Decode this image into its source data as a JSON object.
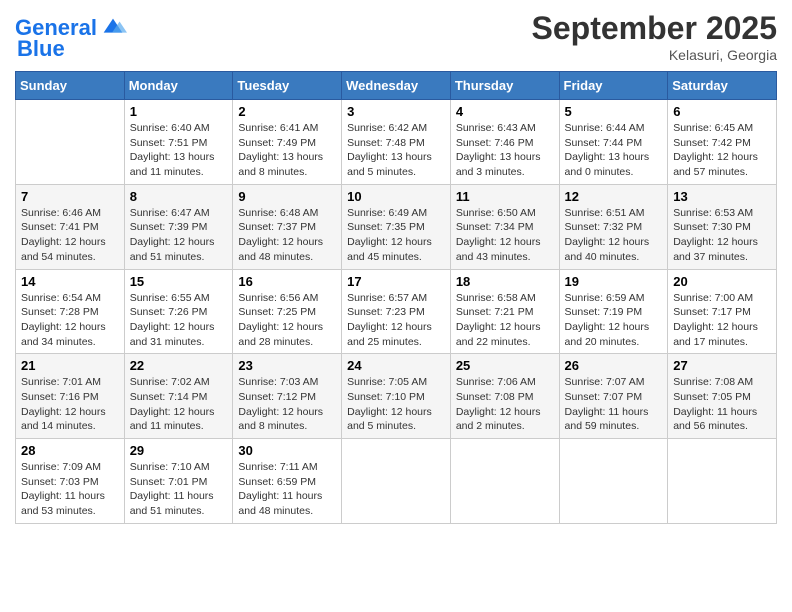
{
  "header": {
    "logo_line1": "General",
    "logo_line2": "Blue",
    "month": "September 2025",
    "location": "Kelasuri, Georgia"
  },
  "days_of_week": [
    "Sunday",
    "Monday",
    "Tuesday",
    "Wednesday",
    "Thursday",
    "Friday",
    "Saturday"
  ],
  "weeks": [
    [
      {
        "day": "",
        "info": ""
      },
      {
        "day": "1",
        "info": "Sunrise: 6:40 AM\nSunset: 7:51 PM\nDaylight: 13 hours\nand 11 minutes."
      },
      {
        "day": "2",
        "info": "Sunrise: 6:41 AM\nSunset: 7:49 PM\nDaylight: 13 hours\nand 8 minutes."
      },
      {
        "day": "3",
        "info": "Sunrise: 6:42 AM\nSunset: 7:48 PM\nDaylight: 13 hours\nand 5 minutes."
      },
      {
        "day": "4",
        "info": "Sunrise: 6:43 AM\nSunset: 7:46 PM\nDaylight: 13 hours\nand 3 minutes."
      },
      {
        "day": "5",
        "info": "Sunrise: 6:44 AM\nSunset: 7:44 PM\nDaylight: 13 hours\nand 0 minutes."
      },
      {
        "day": "6",
        "info": "Sunrise: 6:45 AM\nSunset: 7:42 PM\nDaylight: 12 hours\nand 57 minutes."
      }
    ],
    [
      {
        "day": "7",
        "info": "Sunrise: 6:46 AM\nSunset: 7:41 PM\nDaylight: 12 hours\nand 54 minutes."
      },
      {
        "day": "8",
        "info": "Sunrise: 6:47 AM\nSunset: 7:39 PM\nDaylight: 12 hours\nand 51 minutes."
      },
      {
        "day": "9",
        "info": "Sunrise: 6:48 AM\nSunset: 7:37 PM\nDaylight: 12 hours\nand 48 minutes."
      },
      {
        "day": "10",
        "info": "Sunrise: 6:49 AM\nSunset: 7:35 PM\nDaylight: 12 hours\nand 45 minutes."
      },
      {
        "day": "11",
        "info": "Sunrise: 6:50 AM\nSunset: 7:34 PM\nDaylight: 12 hours\nand 43 minutes."
      },
      {
        "day": "12",
        "info": "Sunrise: 6:51 AM\nSunset: 7:32 PM\nDaylight: 12 hours\nand 40 minutes."
      },
      {
        "day": "13",
        "info": "Sunrise: 6:53 AM\nSunset: 7:30 PM\nDaylight: 12 hours\nand 37 minutes."
      }
    ],
    [
      {
        "day": "14",
        "info": "Sunrise: 6:54 AM\nSunset: 7:28 PM\nDaylight: 12 hours\nand 34 minutes."
      },
      {
        "day": "15",
        "info": "Sunrise: 6:55 AM\nSunset: 7:26 PM\nDaylight: 12 hours\nand 31 minutes."
      },
      {
        "day": "16",
        "info": "Sunrise: 6:56 AM\nSunset: 7:25 PM\nDaylight: 12 hours\nand 28 minutes."
      },
      {
        "day": "17",
        "info": "Sunrise: 6:57 AM\nSunset: 7:23 PM\nDaylight: 12 hours\nand 25 minutes."
      },
      {
        "day": "18",
        "info": "Sunrise: 6:58 AM\nSunset: 7:21 PM\nDaylight: 12 hours\nand 22 minutes."
      },
      {
        "day": "19",
        "info": "Sunrise: 6:59 AM\nSunset: 7:19 PM\nDaylight: 12 hours\nand 20 minutes."
      },
      {
        "day": "20",
        "info": "Sunrise: 7:00 AM\nSunset: 7:17 PM\nDaylight: 12 hours\nand 17 minutes."
      }
    ],
    [
      {
        "day": "21",
        "info": "Sunrise: 7:01 AM\nSunset: 7:16 PM\nDaylight: 12 hours\nand 14 minutes."
      },
      {
        "day": "22",
        "info": "Sunrise: 7:02 AM\nSunset: 7:14 PM\nDaylight: 12 hours\nand 11 minutes."
      },
      {
        "day": "23",
        "info": "Sunrise: 7:03 AM\nSunset: 7:12 PM\nDaylight: 12 hours\nand 8 minutes."
      },
      {
        "day": "24",
        "info": "Sunrise: 7:05 AM\nSunset: 7:10 PM\nDaylight: 12 hours\nand 5 minutes."
      },
      {
        "day": "25",
        "info": "Sunrise: 7:06 AM\nSunset: 7:08 PM\nDaylight: 12 hours\nand 2 minutes."
      },
      {
        "day": "26",
        "info": "Sunrise: 7:07 AM\nSunset: 7:07 PM\nDaylight: 11 hours\nand 59 minutes."
      },
      {
        "day": "27",
        "info": "Sunrise: 7:08 AM\nSunset: 7:05 PM\nDaylight: 11 hours\nand 56 minutes."
      }
    ],
    [
      {
        "day": "28",
        "info": "Sunrise: 7:09 AM\nSunset: 7:03 PM\nDaylight: 11 hours\nand 53 minutes."
      },
      {
        "day": "29",
        "info": "Sunrise: 7:10 AM\nSunset: 7:01 PM\nDaylight: 11 hours\nand 51 minutes."
      },
      {
        "day": "30",
        "info": "Sunrise: 7:11 AM\nSunset: 6:59 PM\nDaylight: 11 hours\nand 48 minutes."
      },
      {
        "day": "",
        "info": ""
      },
      {
        "day": "",
        "info": ""
      },
      {
        "day": "",
        "info": ""
      },
      {
        "day": "",
        "info": ""
      }
    ]
  ]
}
